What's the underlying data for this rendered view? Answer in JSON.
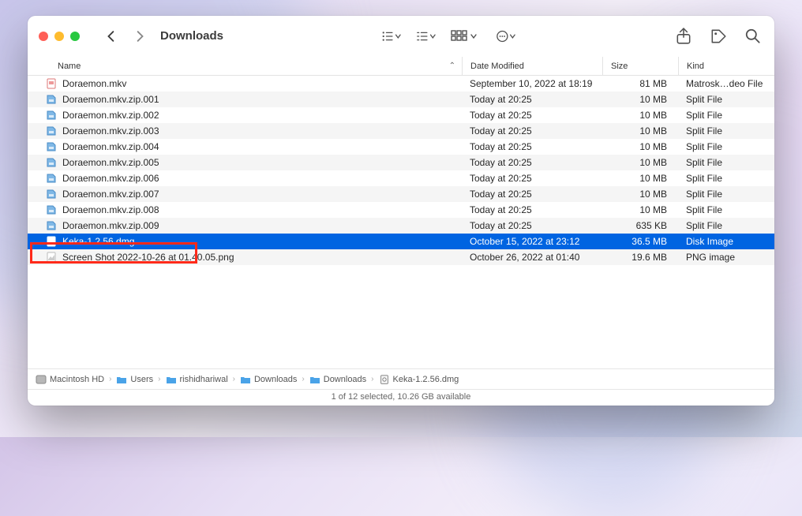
{
  "window": {
    "title": "Downloads"
  },
  "columns": {
    "name": "Name",
    "modified": "Date Modified",
    "size": "Size",
    "kind": "Kind"
  },
  "files": [
    {
      "icon": "mkv",
      "name": "Doraemon.mkv",
      "modified": "September 10, 2022 at 18:19",
      "size": "81 MB",
      "kind": "Matrosk…deo File",
      "selected": false
    },
    {
      "icon": "split",
      "name": "Doraemon.mkv.zip.001",
      "modified": "Today at 20:25",
      "size": "10 MB",
      "kind": "Split File",
      "selected": false
    },
    {
      "icon": "split",
      "name": "Doraemon.mkv.zip.002",
      "modified": "Today at 20:25",
      "size": "10 MB",
      "kind": "Split File",
      "selected": false
    },
    {
      "icon": "split",
      "name": "Doraemon.mkv.zip.003",
      "modified": "Today at 20:25",
      "size": "10 MB",
      "kind": "Split File",
      "selected": false
    },
    {
      "icon": "split",
      "name": "Doraemon.mkv.zip.004",
      "modified": "Today at 20:25",
      "size": "10 MB",
      "kind": "Split File",
      "selected": false
    },
    {
      "icon": "split",
      "name": "Doraemon.mkv.zip.005",
      "modified": "Today at 20:25",
      "size": "10 MB",
      "kind": "Split File",
      "selected": false
    },
    {
      "icon": "split",
      "name": "Doraemon.mkv.zip.006",
      "modified": "Today at 20:25",
      "size": "10 MB",
      "kind": "Split File",
      "selected": false
    },
    {
      "icon": "split",
      "name": "Doraemon.mkv.zip.007",
      "modified": "Today at 20:25",
      "size": "10 MB",
      "kind": "Split File",
      "selected": false
    },
    {
      "icon": "split",
      "name": "Doraemon.mkv.zip.008",
      "modified": "Today at 20:25",
      "size": "10 MB",
      "kind": "Split File",
      "selected": false
    },
    {
      "icon": "split",
      "name": "Doraemon.mkv.zip.009",
      "modified": "Today at 20:25",
      "size": "635 KB",
      "kind": "Split File",
      "selected": false
    },
    {
      "icon": "dmg",
      "name": "Keka-1.2.56.dmg",
      "modified": "October 15, 2022 at 23:12",
      "size": "36.5 MB",
      "kind": "Disk Image",
      "selected": true
    },
    {
      "icon": "png",
      "name": "Screen Shot 2022-10-26 at 01.40.05.png",
      "modified": "October 26, 2022 at 01:40",
      "size": "19.6 MB",
      "kind": "PNG image",
      "selected": false
    }
  ],
  "path": [
    {
      "icon": "disk",
      "label": "Macintosh HD"
    },
    {
      "icon": "folder",
      "label": "Users"
    },
    {
      "icon": "folder",
      "label": "rishidhariwal"
    },
    {
      "icon": "folder",
      "label": "Downloads"
    },
    {
      "icon": "folder",
      "label": "Downloads"
    },
    {
      "icon": "dmg",
      "label": "Keka-1.2.56.dmg"
    }
  ],
  "status": "1 of 12 selected, 10.26 GB available"
}
